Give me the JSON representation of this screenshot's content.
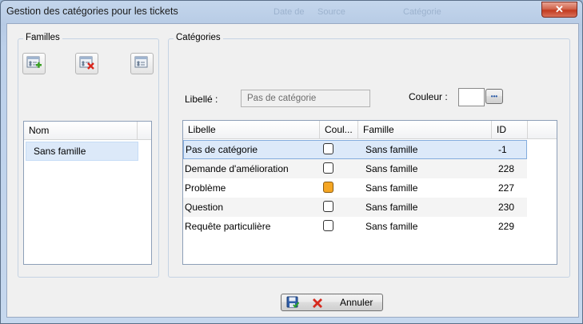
{
  "window": {
    "title": "Gestion des catégories pour les tickets",
    "close_label": "✕",
    "background_labels": [
      "Date de",
      "Source",
      "Catégorie"
    ]
  },
  "familles": {
    "group_label": "Familles",
    "toolbar_icons": [
      "add-family-icon",
      "delete-family-icon",
      "edit-family-icon"
    ],
    "column_header": "Nom",
    "items": [
      "Sans famille"
    ]
  },
  "categories": {
    "group_label": "Catégories",
    "libelle_label": "Libellé :",
    "libelle_value": "Pas de catégorie",
    "couleur_label": "Couleur :",
    "couleur_button": "•••",
    "columns": [
      "Libelle",
      "Coul...",
      "Famille",
      "ID"
    ],
    "rows": [
      {
        "libelle": "Pas de catégorie",
        "color": "#ffffff",
        "famille": "Sans famille",
        "id": "-1"
      },
      {
        "libelle": "Demande d'amélioration",
        "color": "#ffffff",
        "famille": "Sans famille",
        "id": "228"
      },
      {
        "libelle": "Problème",
        "color": "#f5a623",
        "famille": "Sans famille",
        "id": "227"
      },
      {
        "libelle": "Question",
        "color": "#ffffff",
        "famille": "Sans famille",
        "id": "230"
      },
      {
        "libelle": "Requête particulière",
        "color": "#ffffff",
        "famille": "Sans famille",
        "id": "229"
      }
    ]
  },
  "footer": {
    "cancel_label": "Annuler",
    "save_icon": "save-icon",
    "cancel_icon": "cancel-x-icon"
  },
  "colors": {
    "selection": "#dce9f9",
    "selection_border": "#84acdd",
    "alt_row": "#f4f4f4"
  }
}
